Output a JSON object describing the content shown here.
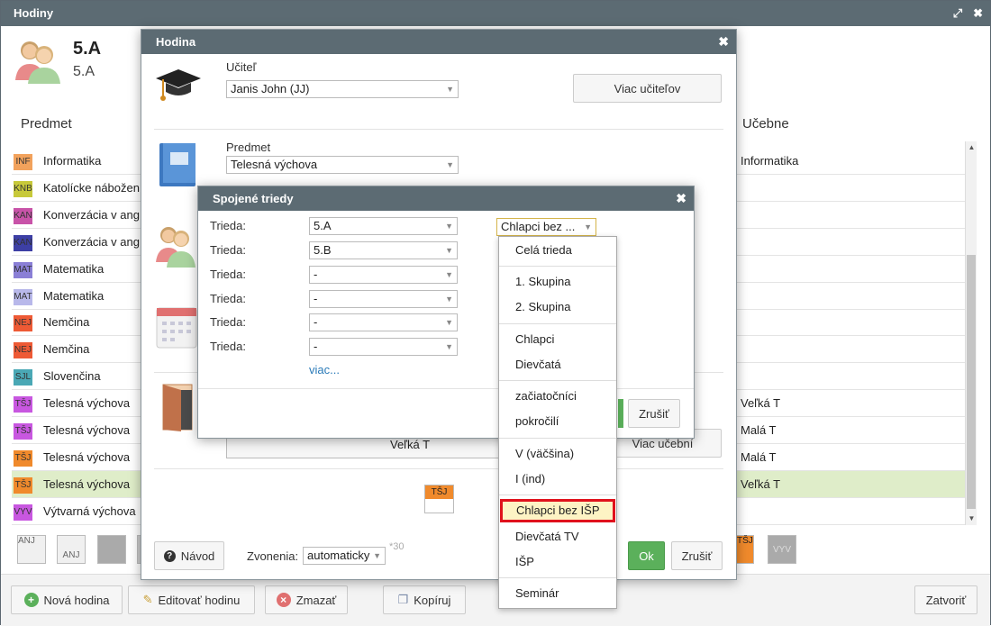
{
  "window": {
    "title": "Hodiny"
  },
  "class_header": {
    "title": "5.A",
    "subtitle": "5.A"
  },
  "columns": {
    "subject": "Predmet",
    "rooms": "Učebne"
  },
  "rows": [
    {
      "badge": "INF",
      "badge_color": "#f2a25c",
      "name": "Informatika",
      "room": "Informatika"
    },
    {
      "badge": "KNB",
      "badge_color": "#c7c93a",
      "name": "Katolícke nábožen",
      "room": ""
    },
    {
      "badge": "KAN",
      "badge_color": "#c853a8",
      "name": "Konverzácia v ang",
      "room": ""
    },
    {
      "badge": "KAN",
      "badge_color": "#3d3fa5",
      "name": "Konverzácia v ang",
      "room": ""
    },
    {
      "badge": "MAT",
      "badge_color": "#8a7fd6",
      "name": "Matematika",
      "room": ""
    },
    {
      "badge": "MAT",
      "badge_color": "#b8b8ea",
      "name": "Matematika",
      "room": ""
    },
    {
      "badge": "NEJ",
      "badge_color": "#ee5a35",
      "name": "Nemčina",
      "room": ""
    },
    {
      "badge": "NEJ",
      "badge_color": "#ee5a35",
      "name": "Nemčina",
      "room": ""
    },
    {
      "badge": "SJL",
      "badge_color": "#4aa8b5",
      "name": "Slovenčina",
      "room": ""
    },
    {
      "badge": "TŠJ",
      "badge_color": "#c857e0",
      "name": "Telesná výchova",
      "room": "Veľká T"
    },
    {
      "badge": "TŠJ",
      "badge_color": "#c857e0",
      "name": "Telesná výchova",
      "room": "Malá T"
    },
    {
      "badge": "TŠJ",
      "badge_color": "#f08a2c",
      "name": "Telesná výchova",
      "room": "Malá T"
    },
    {
      "badge": "TŠJ",
      "badge_color": "#f08a2c",
      "name": "Telesná výchova",
      "room": "Veľká T"
    },
    {
      "badge": "VYV",
      "badge_color": "#c857e0",
      "name": "Výtvarná výchova",
      "room": ""
    }
  ],
  "tiles": {
    "t1": "ANJ",
    "t2": "ANJ",
    "t3": "TŠJ",
    "t4": "VYV"
  },
  "footer": {
    "new": "Nová hodina",
    "edit": "Editovať hodinu",
    "delete": "Zmazať",
    "copy": "Kopíruj",
    "close": "Zatvoriť"
  },
  "lesson_dialog": {
    "title": "Hodina",
    "teacher_label": "Učiteľ",
    "teacher_value": "Janis John (JJ)",
    "more_teachers": "Viac učiteľov",
    "subject_label": "Predmet",
    "subject_value": "Telesná výchova",
    "room_value": "Veľká T",
    "more_rooms": "Viac učební",
    "tile_badge": "TŠJ",
    "help": "Návod",
    "bells_label": "Zvonenia:",
    "bells_value": "automaticky",
    "bells_note": "*30",
    "ok": "Ok",
    "cancel": "Zrušiť"
  },
  "joined_dialog": {
    "title": "Spojené triedy",
    "row_label": "Trieda:",
    "classes": [
      "5.A",
      "5.B",
      "-",
      "-",
      "-",
      "-"
    ],
    "more": "viac...",
    "group_value": "Chlapci bez ...",
    "cancel": "Zrušiť"
  },
  "group_menu": {
    "items": [
      "Celá trieda",
      "1. Skupina",
      "2. Skupina",
      "Chlapci",
      "Dievčatá",
      "začiatočníci",
      "pokročilí",
      "V (väčšina)",
      "I (ind)",
      "Chlapci bez IŠP",
      "Dievčatá TV",
      "IŠP",
      "Seminár"
    ],
    "highlighted": "Chlapci bez IŠP"
  }
}
